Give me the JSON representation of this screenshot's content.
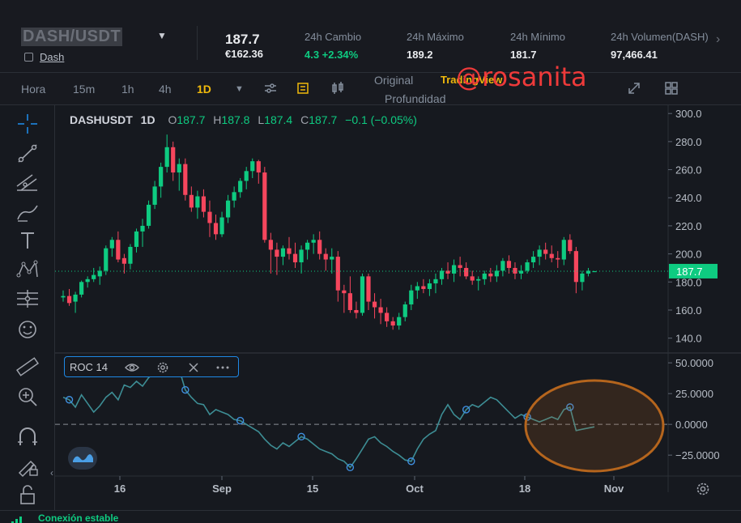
{
  "header": {
    "symbol": "DASH/USDT",
    "coin_link": "Dash",
    "last_price": "187.7",
    "fiat_price": "€162.36",
    "stats": [
      {
        "label": "24h Cambio",
        "value": "4.3 +2.34%",
        "tone": "up"
      },
      {
        "label": "24h Máximo",
        "value": "189.2",
        "tone": "neutral"
      },
      {
        "label": "24h Mínimo",
        "value": "181.7",
        "tone": "neutral"
      },
      {
        "label": "24h Volumen(DASH)",
        "value": "97,466.41",
        "tone": "neutral"
      }
    ]
  },
  "watermark": "@rosanita",
  "toolbar": {
    "timeframes": [
      "Hora",
      "15m",
      "1h",
      "4h",
      "1D"
    ],
    "active_timeframe": "1D",
    "view_original": "Original",
    "view_tradingview": "TradingView",
    "view_depth": "Profundidad",
    "active_view": "TradingView"
  },
  "chart": {
    "legend": {
      "symbol": "DASHUSDT",
      "timeframe": "1D",
      "open_label": "O",
      "open": "187.7",
      "high_label": "H",
      "high": "187.8",
      "low_label": "L",
      "low": "187.4",
      "close_label": "C",
      "close": "187.7",
      "change": "−0.1 (−0.05%)"
    },
    "current_price_tag": "187.7",
    "indicator_label": "ROC 14",
    "status": "Conexión estable"
  },
  "colors": {
    "up": "#0ecb81",
    "down": "#f6465d",
    "accent": "#f0b90b",
    "roc_line": "#3d8d94",
    "highlight": "#b5651d",
    "watermark": "#ee3a3a"
  },
  "chart_data": [
    {
      "type": "candlestick",
      "title": "DASHUSDT 1D",
      "x_ticks": [
        "16",
        "Sep",
        "15",
        "Oct",
        "18",
        "Nov"
      ],
      "y_ticks": [
        "140.0",
        "160.0",
        "180.0",
        "200.0",
        "220.0",
        "240.0",
        "260.0",
        "280.0",
        "300.0"
      ],
      "ylim": [
        130,
        303
      ],
      "current_price": 187.7,
      "candles": [
        [
          169,
          174,
          166,
          170
        ],
        [
          170,
          175,
          163,
          165
        ],
        [
          166,
          173,
          158,
          171
        ],
        [
          171,
          181,
          169,
          180
        ],
        [
          180,
          184,
          176,
          182
        ],
        [
          182,
          190,
          180,
          185
        ],
        [
          184,
          191,
          178,
          188
        ],
        [
          188,
          206,
          185,
          204
        ],
        [
          204,
          212,
          198,
          210
        ],
        [
          210,
          216,
          194,
          196
        ],
        [
          197,
          200,
          186,
          193
        ],
        [
          193,
          207,
          189,
          205
        ],
        [
          205,
          218,
          201,
          216
        ],
        [
          216,
          225,
          205,
          220
        ],
        [
          220,
          238,
          218,
          235
        ],
        [
          235,
          252,
          232,
          248
        ],
        [
          248,
          265,
          240,
          262
        ],
        [
          262,
          285,
          258,
          276
        ],
        [
          276,
          280,
          252,
          258
        ],
        [
          258,
          268,
          245,
          264
        ],
        [
          264,
          268,
          238,
          242
        ],
        [
          242,
          248,
          230,
          233
        ],
        [
          233,
          245,
          225,
          241
        ],
        [
          241,
          246,
          226,
          230
        ],
        [
          230,
          238,
          212,
          222
        ],
        [
          222,
          228,
          210,
          214
        ],
        [
          214,
          230,
          212,
          226
        ],
        [
          226,
          242,
          222,
          238
        ],
        [
          238,
          248,
          233,
          244
        ],
        [
          244,
          254,
          240,
          252
        ],
        [
          252,
          262,
          246,
          259
        ],
        [
          259,
          268,
          254,
          266
        ],
        [
          266,
          267,
          250,
          258
        ],
        [
          258,
          262,
          208,
          210
        ],
        [
          210,
          215,
          186,
          203
        ],
        [
          203,
          208,
          185,
          198
        ],
        [
          198,
          206,
          192,
          204
        ],
        [
          204,
          212,
          196,
          200
        ],
        [
          200,
          208,
          190,
          194
        ],
        [
          194,
          206,
          186,
          203
        ],
        [
          203,
          210,
          196,
          208
        ],
        [
          208,
          214,
          200,
          210
        ],
        [
          210,
          216,
          196,
          200
        ],
        [
          200,
          204,
          188,
          196
        ],
        [
          196,
          204,
          186,
          198
        ],
        [
          198,
          202,
          166,
          174
        ],
        [
          174,
          178,
          158,
          172
        ],
        [
          172,
          184,
          158,
          160
        ],
        [
          160,
          166,
          154,
          158
        ],
        [
          158,
          186,
          156,
          184
        ],
        [
          184,
          186,
          160,
          166
        ],
        [
          166,
          172,
          154,
          162
        ],
        [
          162,
          168,
          150,
          158
        ],
        [
          158,
          162,
          148,
          152
        ],
        [
          152,
          155,
          146,
          149
        ],
        [
          149,
          158,
          146,
          155
        ],
        [
          155,
          166,
          152,
          164
        ],
        [
          164,
          178,
          160,
          174
        ],
        [
          174,
          180,
          168,
          177
        ],
        [
          177,
          182,
          172,
          175
        ],
        [
          175,
          182,
          170,
          179
        ],
        [
          179,
          186,
          172,
          182
        ],
        [
          182,
          190,
          178,
          188
        ],
        [
          188,
          194,
          182,
          186
        ],
        [
          186,
          196,
          180,
          192
        ],
        [
          192,
          198,
          184,
          190
        ],
        [
          190,
          194,
          182,
          184
        ],
        [
          184,
          188,
          178,
          181
        ],
        [
          181,
          184,
          174,
          182
        ],
        [
          182,
          188,
          178,
          186
        ],
        [
          186,
          190,
          180,
          184
        ],
        [
          184,
          192,
          180,
          188
        ],
        [
          188,
          197,
          184,
          195
        ],
        [
          195,
          199,
          186,
          190
        ],
        [
          190,
          194,
          182,
          186
        ],
        [
          186,
          192,
          182,
          188
        ],
        [
          188,
          196,
          186,
          194
        ],
        [
          194,
          202,
          190,
          198
        ],
        [
          198,
          206,
          192,
          203
        ],
        [
          203,
          208,
          196,
          200
        ],
        [
          200,
          206,
          194,
          197
        ],
        [
          197,
          202,
          190,
          196
        ],
        [
          196,
          212,
          192,
          210
        ],
        [
          210,
          214,
          200,
          202
        ],
        [
          202,
          205,
          172,
          180
        ],
        [
          180,
          188,
          174,
          186
        ],
        [
          186,
          190,
          184,
          188
        ],
        [
          187.7,
          187.8,
          187.4,
          187.7
        ]
      ]
    },
    {
      "type": "line",
      "title": "ROC 14",
      "y_ticks": [
        "50.0000",
        "25.0000",
        "0.0000",
        "−25.0000"
      ],
      "ylim": [
        -42,
        58
      ],
      "series": [
        {
          "name": "ROC 14",
          "values": [
            22,
            20,
            14,
            24,
            17,
            10,
            15,
            22,
            26,
            20,
            32,
            30,
            35,
            31,
            38,
            42,
            48,
            50,
            52,
            45,
            28,
            22,
            17,
            16,
            8,
            12,
            10,
            8,
            4,
            3,
            0,
            -3,
            -6,
            -12,
            -17,
            -20,
            -15,
            -18,
            -14,
            -10,
            -12,
            -16,
            -20,
            -22,
            -24,
            -28,
            -30,
            -35,
            -28,
            -20,
            -12,
            -10,
            -15,
            -18,
            -22,
            -25,
            -29,
            -30,
            -20,
            -12,
            -8,
            -5,
            8,
            16,
            8,
            4,
            12,
            16,
            14,
            18,
            22,
            20,
            15,
            10,
            5,
            8,
            6,
            4,
            2,
            4,
            6,
            4,
            12,
            14,
            -5,
            -4,
            -3,
            -2
          ]
        }
      ],
      "markers": [
        1,
        17,
        20,
        29,
        39,
        47,
        57,
        66,
        76,
        83
      ]
    }
  ]
}
